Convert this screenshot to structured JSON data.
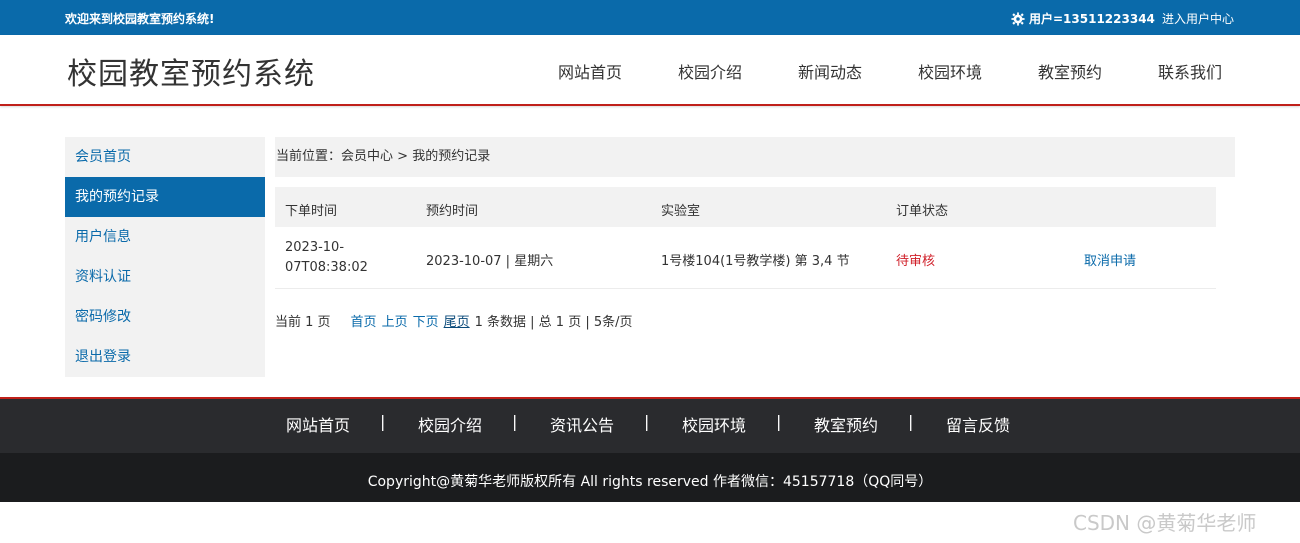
{
  "topbar": {
    "welcome": "欢迎来到校园教室预约系统!",
    "user": "用户=13511223344",
    "user_center": "进入用户中心"
  },
  "header": {
    "title": "校园教室预约系统",
    "nav": [
      "网站首页",
      "校园介绍",
      "新闻动态",
      "校园环境",
      "教室预约",
      "联系我们"
    ]
  },
  "sidebar": {
    "items": [
      "会员首页",
      "我的预约记录",
      "用户信息",
      "资料认证",
      "密码修改",
      "退出登录"
    ],
    "active": "我的预约记录"
  },
  "breadcrumb": {
    "prefix": "当前位置：",
    "level1": "会员中心",
    "sep": " > ",
    "level2": "我的预约记录"
  },
  "table": {
    "headers": [
      "下单时间",
      "预约时间",
      "实验室",
      "订单状态"
    ],
    "rows": [
      {
        "order_time_line1": "2023-10-",
        "order_time_line2": "07T08:38:02",
        "reserve_time": "2023-10-07 | 星期六",
        "lab": "1号楼104(1号教学楼) 第 3,4 节",
        "status": "待审核",
        "action": "取消申请"
      }
    ]
  },
  "pager": {
    "current": "当前 1 页",
    "first": "首页",
    "prev": "上页",
    "next": "下页",
    "last": "尾页",
    "summary": "1 条数据 | 总 1 页 | 5条/页"
  },
  "footer": {
    "nav": [
      "网站首页",
      "校园介绍",
      "资讯公告",
      "校园环境",
      "教室预约",
      "留言反馈"
    ],
    "separator": "|",
    "copyright": "Copyright@黄菊华老师版权所有 All rights reserved 作者微信：45157718（QQ同号）"
  },
  "watermark": "CSDN @黄菊华老师",
  "colors": {
    "brand_blue": "#0a6aaa",
    "accent_red": "#c0201a",
    "status_red": "#d0202a"
  }
}
